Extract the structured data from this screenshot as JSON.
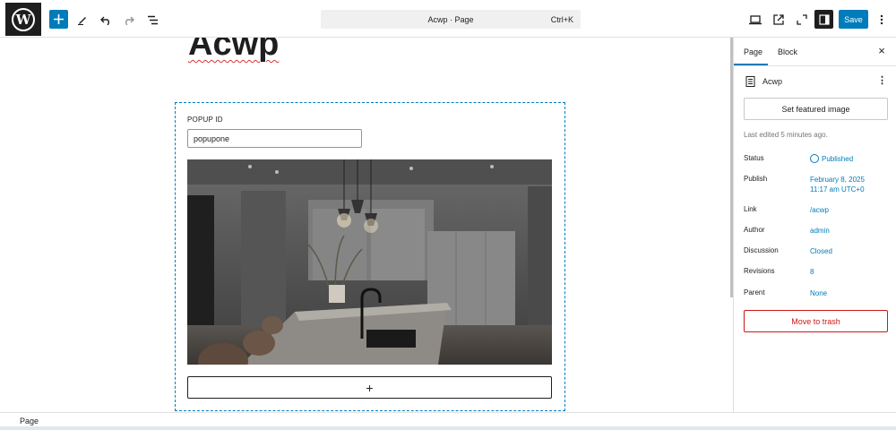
{
  "toolbar": {
    "logo_icon": "wordpress-logo-icon",
    "add_icon": "plus-icon",
    "tools_icon": "pencil-icon",
    "undo_icon": "undo-icon",
    "redo_icon": "redo-icon",
    "outline_icon": "list-view-icon",
    "command_title": "Acwp · Page",
    "command_shortcut": "Ctrl+K",
    "preview_icon": "desktop-icon",
    "view_icon": "external-link-icon",
    "zoom_icon": "zoom-out-icon",
    "settings_icon": "sidebar-icon",
    "save_label": "Save",
    "options_icon": "more-vertical-icon",
    "accent_color": "#007cba"
  },
  "editor": {
    "heading": "Acwp",
    "popup_label": "POPUP ID",
    "popup_value": "popupone",
    "image_icon": "kitchen-photo",
    "appender_label": "+"
  },
  "sidebar": {
    "tabs": [
      {
        "label": "Page",
        "active": true
      },
      {
        "label": "Block",
        "active": false
      }
    ],
    "close_label": "×",
    "doc_icon": "page-icon",
    "doc_title": "Acwp",
    "doc_menu_label": "⋮",
    "featured_label": "Set featured image",
    "last_edited": "Last edited 5 minutes ago.",
    "meta": [
      {
        "key": "Status",
        "value": "Published"
      },
      {
        "key": "Publish",
        "value": "February 8, 2025",
        "value2": "11:17 am UTC+0"
      },
      {
        "key": "Link",
        "value": "/acwp"
      },
      {
        "key": "Author",
        "value": "admin"
      },
      {
        "key": "Discussion",
        "value": "Closed"
      },
      {
        "key": "Revisions",
        "value": "8"
      },
      {
        "key": "Parent",
        "value": "None"
      }
    ],
    "trash_label": "Move to trash",
    "trash_color": "#cc1818"
  },
  "footer": {
    "breadcrumb": "Page"
  }
}
